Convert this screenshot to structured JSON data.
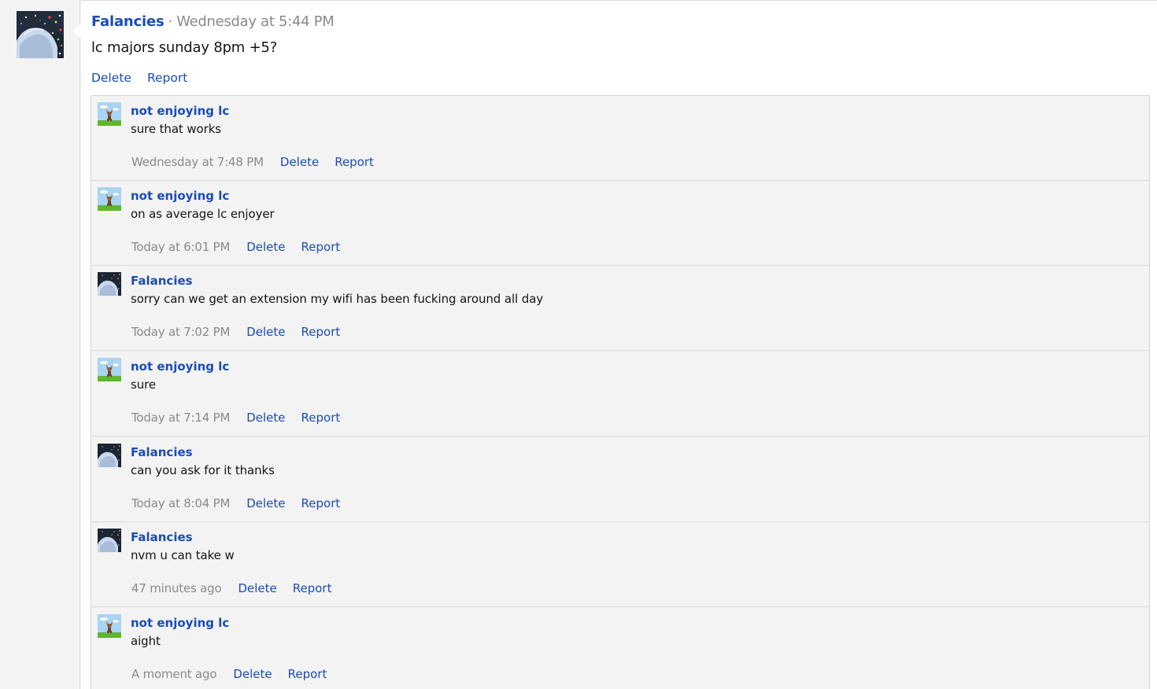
{
  "post": {
    "author": "Falancies",
    "separator": "·",
    "time": "Wednesday at 5:44 PM",
    "body": "lc majors sunday 8pm +5?",
    "actions": {
      "delete": "Delete",
      "report": "Report"
    }
  },
  "comments": [
    {
      "author": "not enjoying lc",
      "avatar": "dog-avatar",
      "text": "sure that works",
      "time": "Wednesday at 7:48 PM",
      "delete": "Delete",
      "report": "Report"
    },
    {
      "author": "not enjoying lc",
      "avatar": "dog-avatar",
      "text": "on as average lc enjoyer",
      "time": "Today at 6:01 PM",
      "delete": "Delete",
      "report": "Report"
    },
    {
      "author": "Falancies",
      "avatar": "night-avatar",
      "text": "sorry can we get an extension my wifi has been fucking around all day",
      "time": "Today at 7:02 PM",
      "delete": "Delete",
      "report": "Report"
    },
    {
      "author": "not enjoying lc",
      "avatar": "dog-avatar",
      "text": "sure",
      "time": "Today at 7:14 PM",
      "delete": "Delete",
      "report": "Report"
    },
    {
      "author": "Falancies",
      "avatar": "night-avatar",
      "text": "can you ask for it thanks",
      "time": "Today at 8:04 PM",
      "delete": "Delete",
      "report": "Report"
    },
    {
      "author": "Falancies",
      "avatar": "night-avatar",
      "text": "nvm u can take w",
      "time": "47 minutes ago",
      "delete": "Delete",
      "report": "Report"
    },
    {
      "author": "not enjoying lc",
      "avatar": "dog-avatar",
      "text": "aight",
      "time": "A moment ago",
      "delete": "Delete",
      "report": "Report"
    }
  ],
  "colors": {
    "link": "#1a4db3",
    "muted": "#8a8a8a",
    "panel": "#f3f3f3",
    "border": "#d9d9d9"
  }
}
